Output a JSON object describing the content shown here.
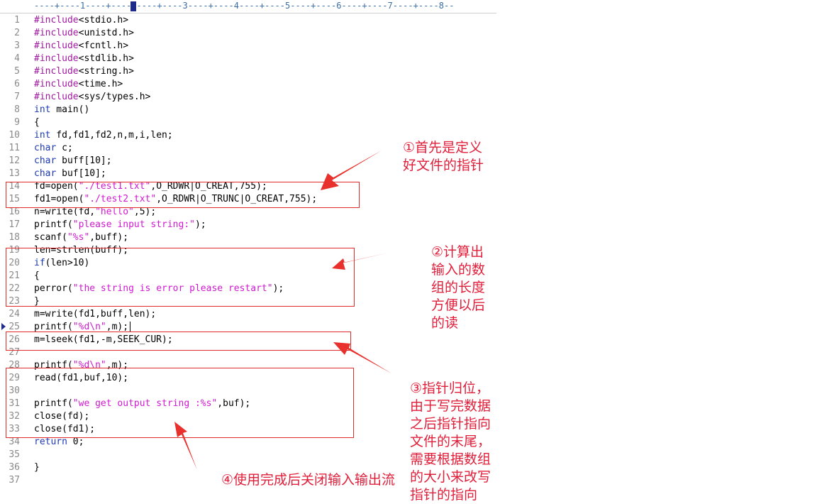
{
  "ruler": {
    "text": "----+----1----+----2----+----3----+----4----+----5----+----6----+----7----+----8--"
  },
  "lines": [
    {
      "n": "1",
      "segs": [
        [
          "pp",
          "#include"
        ],
        [
          "t",
          "<stdio.h>"
        ]
      ]
    },
    {
      "n": "2",
      "segs": [
        [
          "pp",
          "#include"
        ],
        [
          "t",
          "<unistd.h>"
        ]
      ]
    },
    {
      "n": "3",
      "segs": [
        [
          "pp",
          "#include"
        ],
        [
          "t",
          "<fcntl.h>"
        ]
      ]
    },
    {
      "n": "4",
      "segs": [
        [
          "pp",
          "#include"
        ],
        [
          "t",
          "<stdlib.h>"
        ]
      ]
    },
    {
      "n": "5",
      "segs": [
        [
          "pp",
          "#include"
        ],
        [
          "t",
          "<string.h>"
        ]
      ]
    },
    {
      "n": "6",
      "segs": [
        [
          "pp",
          "#include"
        ],
        [
          "t",
          "<time.h>"
        ]
      ]
    },
    {
      "n": "7",
      "segs": [
        [
          "pp",
          "#include"
        ],
        [
          "t",
          "<sys/types.h>"
        ]
      ]
    },
    {
      "n": "8",
      "segs": [
        [
          "kw",
          "int"
        ],
        [
          "t",
          " main()"
        ]
      ]
    },
    {
      "n": "9",
      "segs": [
        [
          "t",
          "{"
        ]
      ]
    },
    {
      "n": "10",
      "segs": [
        [
          "kw",
          "int"
        ],
        [
          "t",
          " fd,fd1,fd2,n,m,i,len;"
        ]
      ]
    },
    {
      "n": "11",
      "segs": [
        [
          "kw",
          "char"
        ],
        [
          "t",
          " c;"
        ]
      ]
    },
    {
      "n": "12",
      "segs": [
        [
          "kw",
          "char"
        ],
        [
          "t",
          " buff[10];"
        ]
      ]
    },
    {
      "n": "13",
      "segs": [
        [
          "kw",
          "char"
        ],
        [
          "t",
          " buf[10];"
        ]
      ]
    },
    {
      "n": "14",
      "segs": [
        [
          "t",
          "fd=open("
        ],
        [
          "str",
          "\"./test1.txt\""
        ],
        [
          "t",
          ",O_RDWR|O_CREAT,755);"
        ]
      ]
    },
    {
      "n": "15",
      "segs": [
        [
          "t",
          "fd1=open("
        ],
        [
          "str",
          "\"./test2.txt\""
        ],
        [
          "t",
          ",O_RDWR|O_TRUNC|O_CREAT,755);"
        ]
      ]
    },
    {
      "n": "16",
      "segs": [
        [
          "t",
          "n=write(fd,"
        ],
        [
          "str",
          "\"hello\""
        ],
        [
          "t",
          ",5);"
        ]
      ]
    },
    {
      "n": "17",
      "segs": [
        [
          "t",
          "printf("
        ],
        [
          "str",
          "\"please input string:\""
        ],
        [
          "t",
          ");"
        ]
      ]
    },
    {
      "n": "18",
      "segs": [
        [
          "t",
          "scanf("
        ],
        [
          "str",
          "\"%s\""
        ],
        [
          "t",
          ",buff);"
        ]
      ]
    },
    {
      "n": "19",
      "segs": [
        [
          "t",
          "len=strlen(buff);"
        ]
      ]
    },
    {
      "n": "20",
      "segs": [
        [
          "kw",
          "if"
        ],
        [
          "t",
          "(len>10)"
        ]
      ]
    },
    {
      "n": "21",
      "segs": [
        [
          "t",
          "{"
        ]
      ]
    },
    {
      "n": "22",
      "segs": [
        [
          "t",
          "perror("
        ],
        [
          "str",
          "\"the string is error please restart\""
        ],
        [
          "t",
          ");"
        ]
      ]
    },
    {
      "n": "23",
      "segs": [
        [
          "t",
          "}"
        ]
      ]
    },
    {
      "n": "24",
      "segs": [
        [
          "t",
          "m=write(fd1,buff,len);"
        ]
      ]
    },
    {
      "n": "25",
      "segs": [
        [
          "t",
          "printf("
        ],
        [
          "str",
          "\"%d\\n\""
        ],
        [
          "t",
          ",m);"
        ]
      ]
    },
    {
      "n": "26",
      "segs": [
        [
          "t",
          "m=lseek(fd1,-m,SEEK_CUR);"
        ]
      ]
    },
    {
      "n": "27",
      "segs": []
    },
    {
      "n": "28",
      "segs": [
        [
          "t",
          "printf("
        ],
        [
          "str",
          "\"%d\\n\""
        ],
        [
          "t",
          ",m);"
        ]
      ]
    },
    {
      "n": "29",
      "segs": [
        [
          "t",
          "read(fd1,buf,10);"
        ]
      ]
    },
    {
      "n": "30",
      "segs": []
    },
    {
      "n": "31",
      "segs": [
        [
          "t",
          "printf("
        ],
        [
          "str",
          "\"we get output string :%s\""
        ],
        [
          "t",
          ",buf);"
        ]
      ]
    },
    {
      "n": "32",
      "segs": [
        [
          "t",
          "close(fd);"
        ]
      ]
    },
    {
      "n": "33",
      "segs": [
        [
          "t",
          "close(fd1);"
        ]
      ]
    },
    {
      "n": "34",
      "segs": [
        [
          "kw",
          "return"
        ],
        [
          "t",
          " 0;"
        ]
      ]
    },
    {
      "n": "35",
      "segs": []
    },
    {
      "n": "36",
      "segs": [
        [
          "t",
          "}"
        ]
      ]
    },
    {
      "n": "37",
      "segs": []
    }
  ],
  "notes": {
    "note1": "①首先是定义\n好文件的指针",
    "note2": "②计算出\n输入的数\n组的长度\n方便以后\n的读",
    "note3": "③指针归位，\n由于写完数据\n之后指针指向\n文件的末尾，\n需要根据数组\n的大小来改写\n指针的指向",
    "note4": "④使用完成后关闭输入输出流"
  },
  "colors": {
    "annotation": "#e01e3a",
    "box": "#e02b2b",
    "keyword": "#1e3ab5",
    "string": "#d01ad0",
    "preprocessor": "#a01aa0"
  }
}
